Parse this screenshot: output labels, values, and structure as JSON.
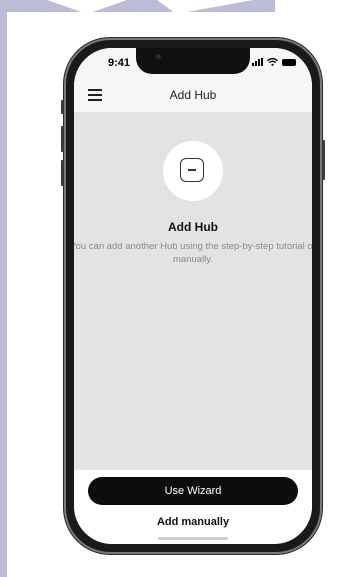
{
  "status_bar": {
    "time": "9:41",
    "signal_icon": "signal-icon",
    "wifi_icon": "wifi-icon",
    "battery_icon": "battery-icon"
  },
  "nav": {
    "title": "Add Hub",
    "menu_icon": "menu-icon"
  },
  "content": {
    "hub_icon": "hub-device-icon",
    "heading": "Add Hub",
    "description": "You can add another Hub using the step-by-step tutorial or manually."
  },
  "actions": {
    "wizard_label": "Use Wizard",
    "manual_label": "Add manually"
  },
  "colors": {
    "primary_button": "#0d0d0d",
    "screen_background": "#e3e3e3",
    "backdrop_accent": "#bcbcd6"
  }
}
